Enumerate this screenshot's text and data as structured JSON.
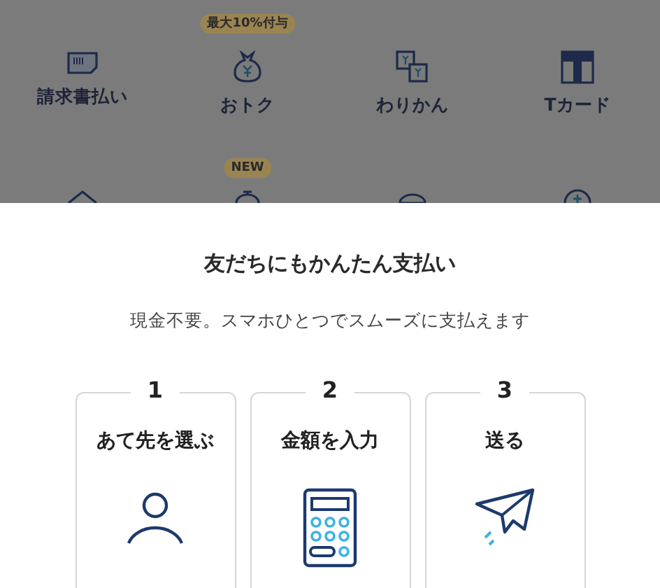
{
  "menu": [
    {
      "label": "請求書払い"
    },
    {
      "label": "おトク",
      "badge": "最大10%付与"
    },
    {
      "label": "わりかん"
    },
    {
      "label": "Tカード"
    }
  ],
  "menu_row_2_badge": "NEW",
  "sheet": {
    "title": "友だちにもかんたん支払い",
    "subtitle": "現金不要。スマホひとつでスムーズに支払えます",
    "steps": [
      {
        "number": "1",
        "label": "あて先を選ぶ"
      },
      {
        "number": "2",
        "label": "金額を入力"
      },
      {
        "number": "3",
        "label": "送る"
      }
    ]
  }
}
